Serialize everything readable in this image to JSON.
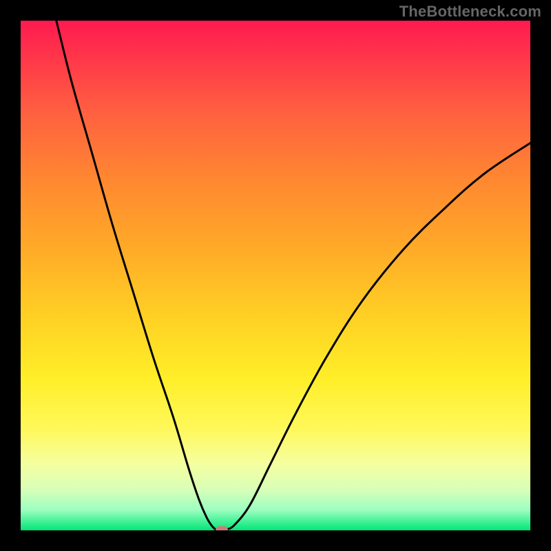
{
  "watermark": "TheBottleneck.com",
  "colors": {
    "frame": "#000000",
    "curve": "#000000",
    "dot": "#cf7a7a",
    "gradient_top": "#ff1a50",
    "gradient_bottom": "#00e676"
  },
  "chart_data": {
    "type": "line",
    "title": "",
    "xlabel": "",
    "ylabel": "",
    "xlim": [
      0,
      100
    ],
    "ylim": [
      0,
      100
    ],
    "grid": false,
    "series": [
      {
        "name": "left-branch",
        "x": [
          7,
          10,
          14,
          18,
          22,
          26,
          30,
          33,
          35,
          36.5,
          37.5,
          38.2
        ],
        "values": [
          100,
          88,
          74,
          60,
          47,
          34,
          22,
          12,
          6,
          2.5,
          0.9,
          0.2
        ]
      },
      {
        "name": "right-branch",
        "x": [
          40.6,
          42,
          45,
          49,
          54,
          60,
          67,
          75,
          83,
          91,
          100
        ],
        "values": [
          0.2,
          1.1,
          5,
          13,
          23,
          34,
          45,
          55,
          63,
          70,
          76
        ]
      }
    ],
    "sweet_spot": {
      "x": 39.4,
      "y": 0
    },
    "annotations": []
  }
}
